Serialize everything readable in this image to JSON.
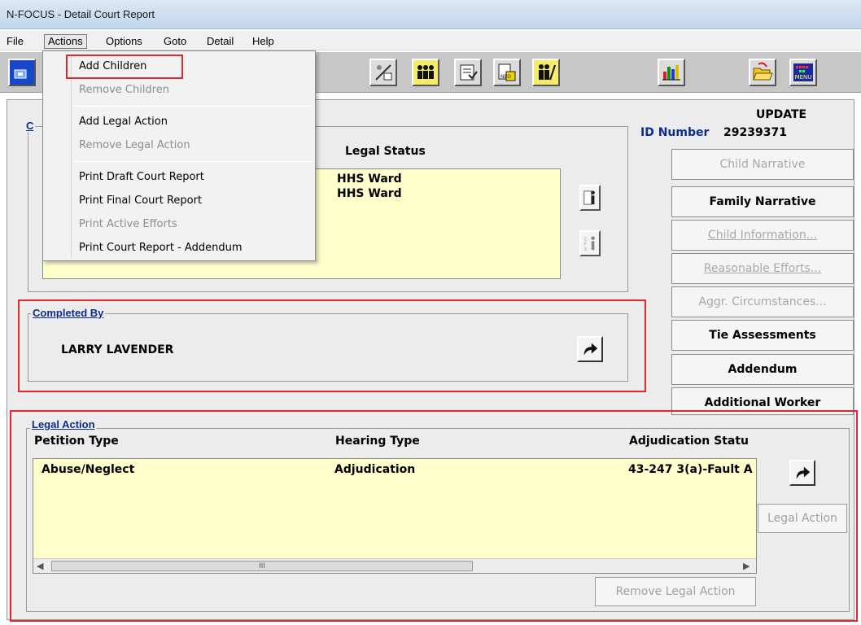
{
  "window": {
    "title": "N-FOCUS - Detail Court Report"
  },
  "menubar": {
    "items": [
      {
        "label": "File"
      },
      {
        "label": "Actions"
      },
      {
        "label": "Options"
      },
      {
        "label": "Goto"
      },
      {
        "label": "Detail"
      },
      {
        "label": "Help"
      }
    ]
  },
  "actions_menu": {
    "items": [
      {
        "label": "Add Children",
        "enabled": true
      },
      {
        "label": "Remove Children",
        "enabled": false
      },
      {
        "label": "Add Legal Action",
        "enabled": true
      },
      {
        "label": "Remove Legal Action",
        "enabled": false
      },
      {
        "label": "Print Draft Court Report",
        "enabled": true
      },
      {
        "label": "Print Final Court Report",
        "enabled": true
      },
      {
        "label": "Print Active Efforts",
        "enabled": false
      },
      {
        "label": "Print Court Report - Addendum",
        "enabled": true
      }
    ]
  },
  "toolbar": {
    "icons": [
      "window-icon",
      "tools-icon",
      "people-group-icon",
      "checklist-icon",
      "neo-info-icon",
      "family-icon",
      "bar-chart-icon",
      "open-folder-icon",
      "menu-icon"
    ],
    "menu_icon_label": "MENU"
  },
  "header": {
    "mode": "UPDATE",
    "id_label": "ID Number",
    "id_value": "29239371"
  },
  "children": {
    "legend": "C",
    "column_header": "Legal Status",
    "rows": [
      {
        "legal_status": "HHS Ward"
      },
      {
        "legal_status": "HHS Ward"
      }
    ]
  },
  "completed_by": {
    "legend": "Completed By",
    "name": "LARRY LAVENDER"
  },
  "side_buttons": [
    {
      "label": "Child Narrative",
      "enabled": false
    },
    {
      "label": "Family Narrative",
      "enabled": true
    },
    {
      "label": "Child Information...",
      "enabled": false
    },
    {
      "label": "Reasonable Efforts...",
      "enabled": false
    },
    {
      "label": "Aggr. Circumstances...",
      "enabled": false
    },
    {
      "label": "Tie Assessments",
      "enabled": true
    },
    {
      "label": "Addendum",
      "enabled": true
    },
    {
      "label": "Additional Worker",
      "enabled": true
    }
  ],
  "legal_action": {
    "legend": "Legal Action",
    "columns": [
      "Petition Type",
      "Hearing Type",
      "Adjudication Statu"
    ],
    "rows": [
      {
        "petition_type": "Abuse/Neglect",
        "hearing_type": "Adjudication",
        "adjudication_status": "43-247 3(a)-Fault A"
      }
    ],
    "scroll_thumb_label": "III",
    "legal_action_button": "Legal Action",
    "remove_button": "Remove Legal Action"
  },
  "colors": {
    "highlight": "#e0282e",
    "legend_blue": "#0a2c8c",
    "list_bg": "#ffffcc",
    "panel_bg": "#ececec",
    "toolbar_bg": "#c7c7c7"
  }
}
